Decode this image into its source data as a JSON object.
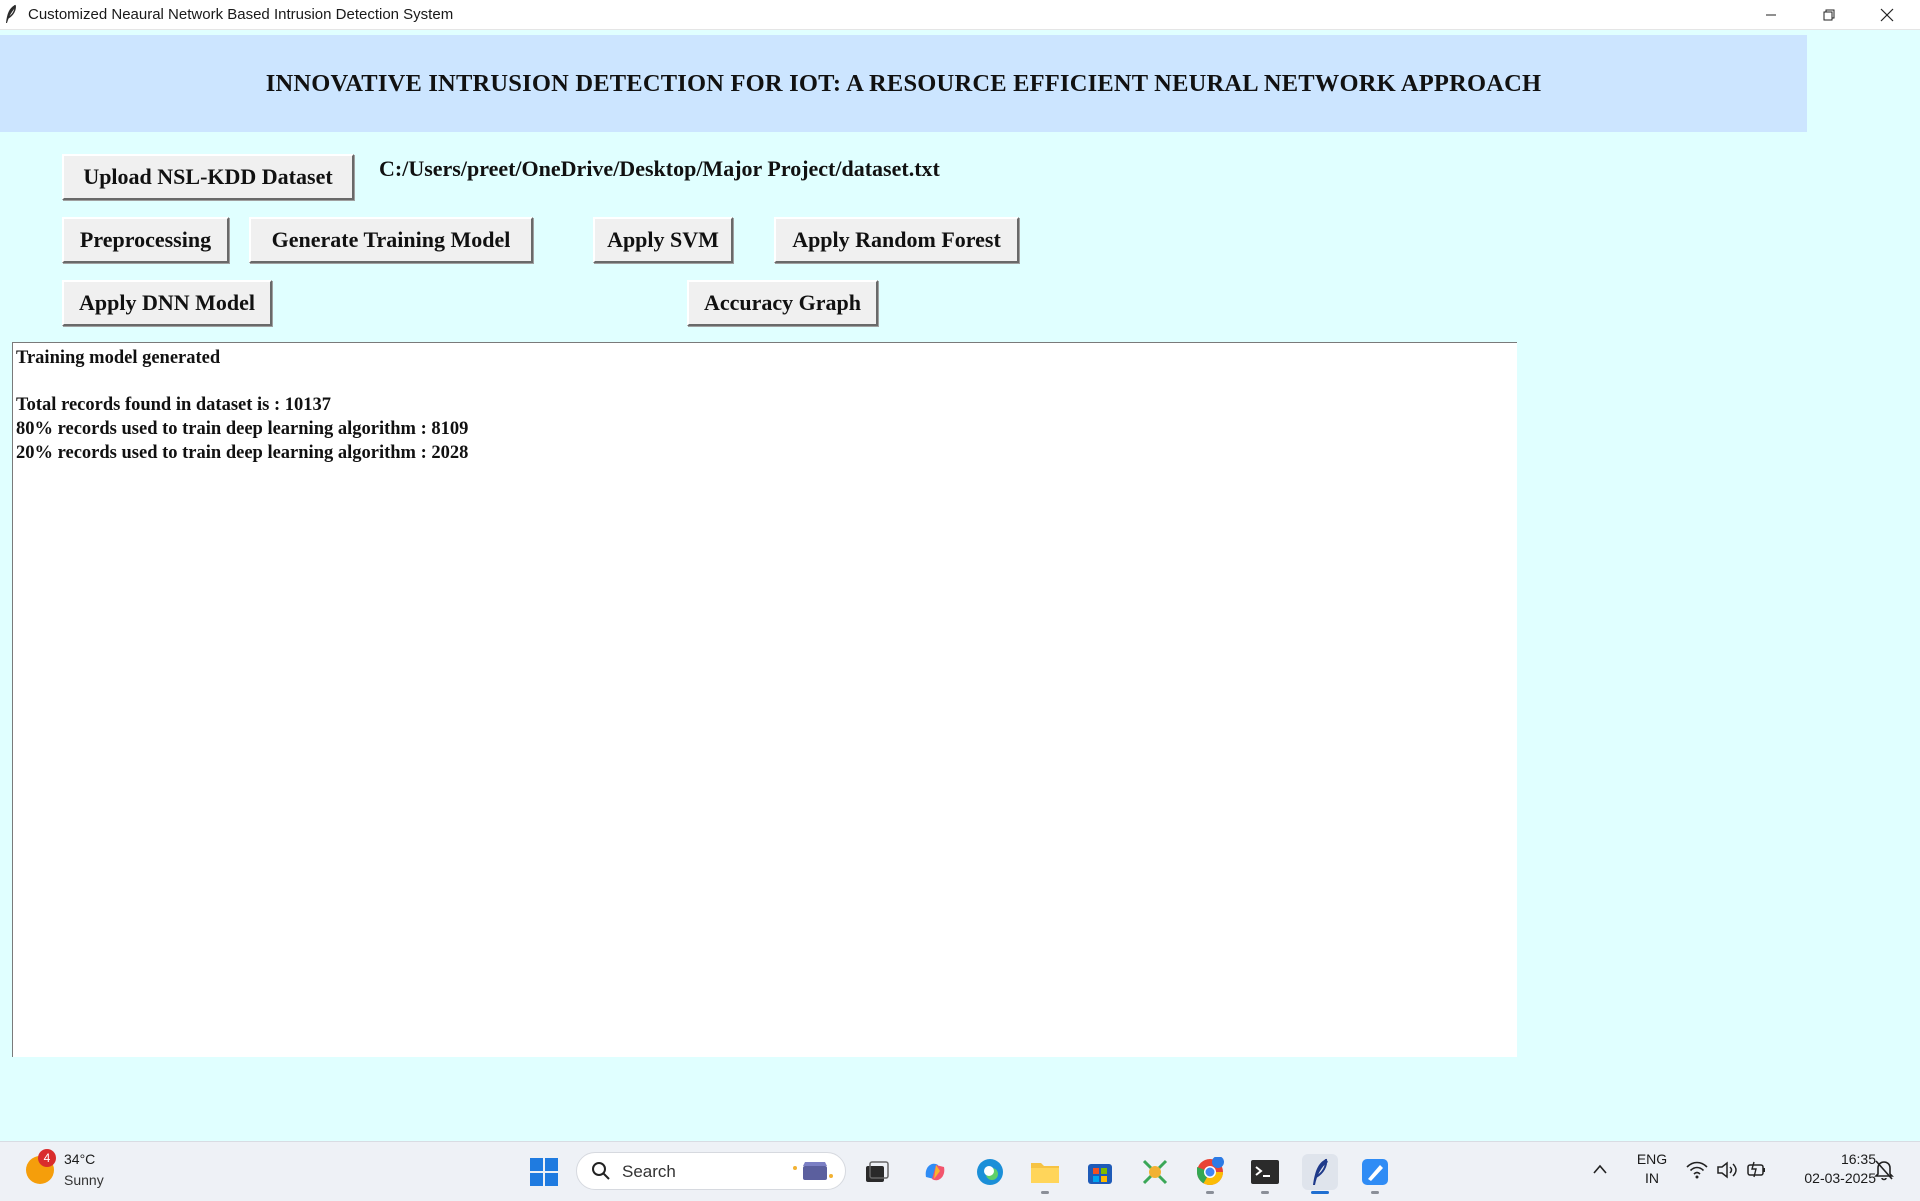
{
  "window": {
    "title": "Customized Neaural Network Based Intrusion Detection System",
    "controls": [
      "minimize-icon",
      "restore-icon",
      "close-icon"
    ]
  },
  "header": {
    "title": "INNOVATIVE INTRUSION DETECTION FOR IOT: A RESOURCE EFFICIENT NEURAL NETWORK APPROACH"
  },
  "toolbar": {
    "upload_label": "Upload NSL-KDD Dataset",
    "dataset_path": "C:/Users/preet/OneDrive/Desktop/Major Project/dataset.txt",
    "preprocessing_label": "Preprocessing",
    "generate_label": "Generate Training Model",
    "svm_label": "Apply SVM",
    "rf_label": "Apply Random Forest",
    "dnn_label": "Apply DNN Model",
    "graph_label": "Accuracy Graph"
  },
  "output": {
    "lines": [
      "Training model generated",
      "",
      "Total records found in dataset is : 10137",
      "80% records used to train deep learning algorithm : 8109",
      "20% records used to train deep learning algorithm : 2028"
    ]
  },
  "taskbar": {
    "weather": {
      "badge": "4",
      "temp": "34°C",
      "condition": "Sunny"
    },
    "search_placeholder": "Search",
    "apps": [
      "windows-start-icon",
      "search-icon",
      "task-view-icon",
      "copilot-icon",
      "edge-icon",
      "file-explorer-icon",
      "store-icon",
      "photos-icon",
      "chrome-icon",
      "terminal-icon",
      "python-feather-icon",
      "paint-icon"
    ],
    "tray": {
      "lang_top": "ENG",
      "lang_bottom": "IN",
      "time": "16:35",
      "date": "02-03-2025"
    }
  },
  "colors": {
    "background": "#e0ffff",
    "header_band": "#cce5ff",
    "button_face": "#f0f0f0",
    "output_bg": "#ffffff"
  }
}
